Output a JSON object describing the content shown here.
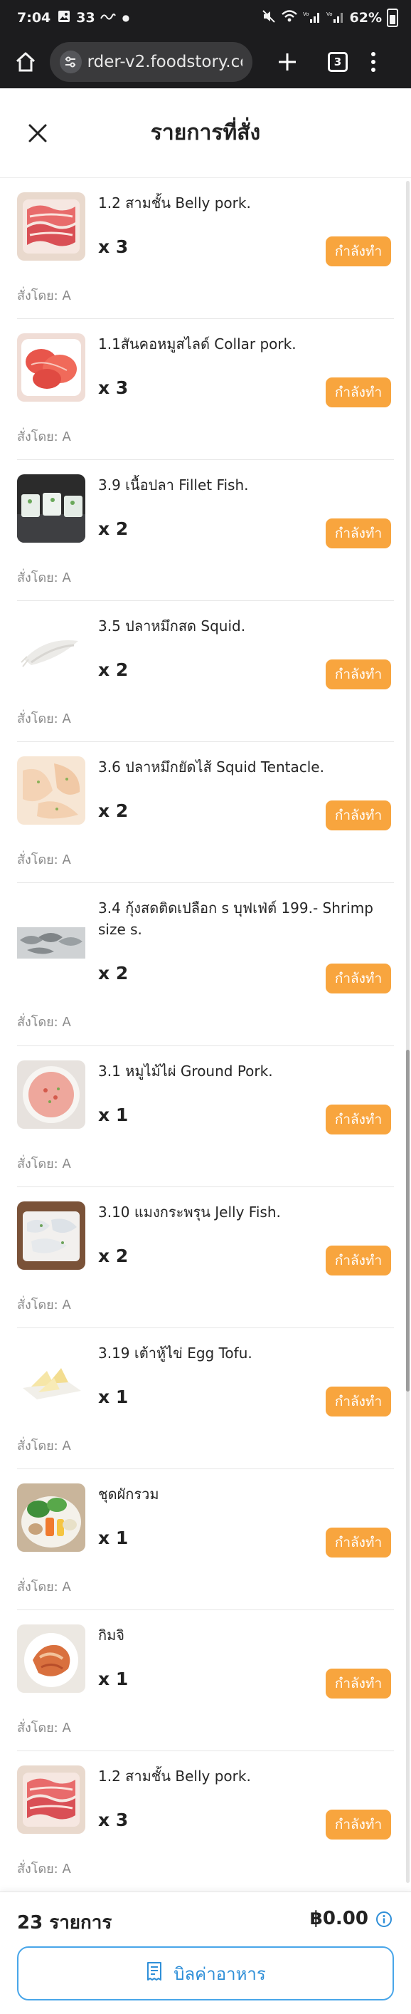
{
  "status_bar": {
    "time": "7:04",
    "notification_count": "33",
    "signal_1_label": "Vo))\nLTE1",
    "signal_2_label": "Vo))\nLTE2",
    "battery": "62%"
  },
  "browser": {
    "url": "rder-v2.foodstory.co",
    "tab_count": "3"
  },
  "header": {
    "title": "รายการที่สั่ง"
  },
  "ordered_by_label": "สั่งโดย: A",
  "items": [
    {
      "name": "1.2 สามชั้น Belly pork.",
      "qty": "x 3",
      "status": "กำลังทำ",
      "ordered_by": "สั่งโดย: A",
      "icon": "pork-slices-image"
    },
    {
      "name": "1.1สันคอหมูสไลด์ Collar pork.",
      "qty": "x 3",
      "status": "กำลังทำ",
      "ordered_by": "สั่งโดย: A",
      "icon": "collar-pork-image"
    },
    {
      "name": "3.9 เนื้อปลา Fillet Fish.",
      "qty": "x 2",
      "status": "กำลังทำ",
      "ordered_by": "สั่งโดย: A",
      "icon": "fish-fillet-image"
    },
    {
      "name": "3.5 ปลาหมึกสด Squid.",
      "qty": "x 2",
      "status": "กำลังทำ",
      "ordered_by": "สั่งโดย: A",
      "icon": "squid-image"
    },
    {
      "name": "3.6 ปลาหมึกยัดไส้ Squid Tentacle.",
      "qty": "x 2",
      "status": "กำลังทำ",
      "ordered_by": "สั่งโดย: A",
      "icon": "squid-tentacle-image"
    },
    {
      "name": "3.4 กุ้งสดติดเปลือก s บุฟเฟ่ต์ 199.- Shrimp size s.",
      "qty": "x 2",
      "status": "กำลังทำ",
      "ordered_by": "สั่งโดย: A",
      "icon": "shrimp-image"
    },
    {
      "name": "3.1 หมูไม้ไผ่ Ground Pork.",
      "qty": "x 1",
      "status": "กำลังทำ",
      "ordered_by": "สั่งโดย: A",
      "icon": "ground-pork-image"
    },
    {
      "name": "3.10 แมงกระพรุน Jelly Fish.",
      "qty": "x 2",
      "status": "กำลังทำ",
      "ordered_by": "สั่งโดย: A",
      "icon": "jelly-fish-image"
    },
    {
      "name": "3.19 เต้าหู้ไข่ Egg Tofu.",
      "qty": "x 1",
      "status": "กำลังทำ",
      "ordered_by": "สั่งโดย: A",
      "icon": "egg-tofu-image"
    },
    {
      "name": "ชุดผักรวม",
      "qty": "x 1",
      "status": "กำลังทำ",
      "ordered_by": "สั่งโดย: A",
      "icon": "vegetable-set-image"
    },
    {
      "name": "กิมจิ",
      "qty": "x 1",
      "status": "กำลังทำ",
      "ordered_by": "สั่งโดย: A",
      "icon": "kimchi-image"
    },
    {
      "name": "1.2 สามชั้น Belly pork.",
      "qty": "x 3",
      "status": "กำลังทำ",
      "ordered_by": "สั่งโดย: A",
      "icon": "pork-slices-image"
    }
  ],
  "footer": {
    "count": "23 รายการ",
    "total": "฿0.00",
    "bill_button": "บิลค่าอาหาร"
  },
  "colors": {
    "status_orange": "#f8a53e",
    "bill_blue": "#2f8fd8",
    "chrome_dark": "#1c1c1e"
  }
}
